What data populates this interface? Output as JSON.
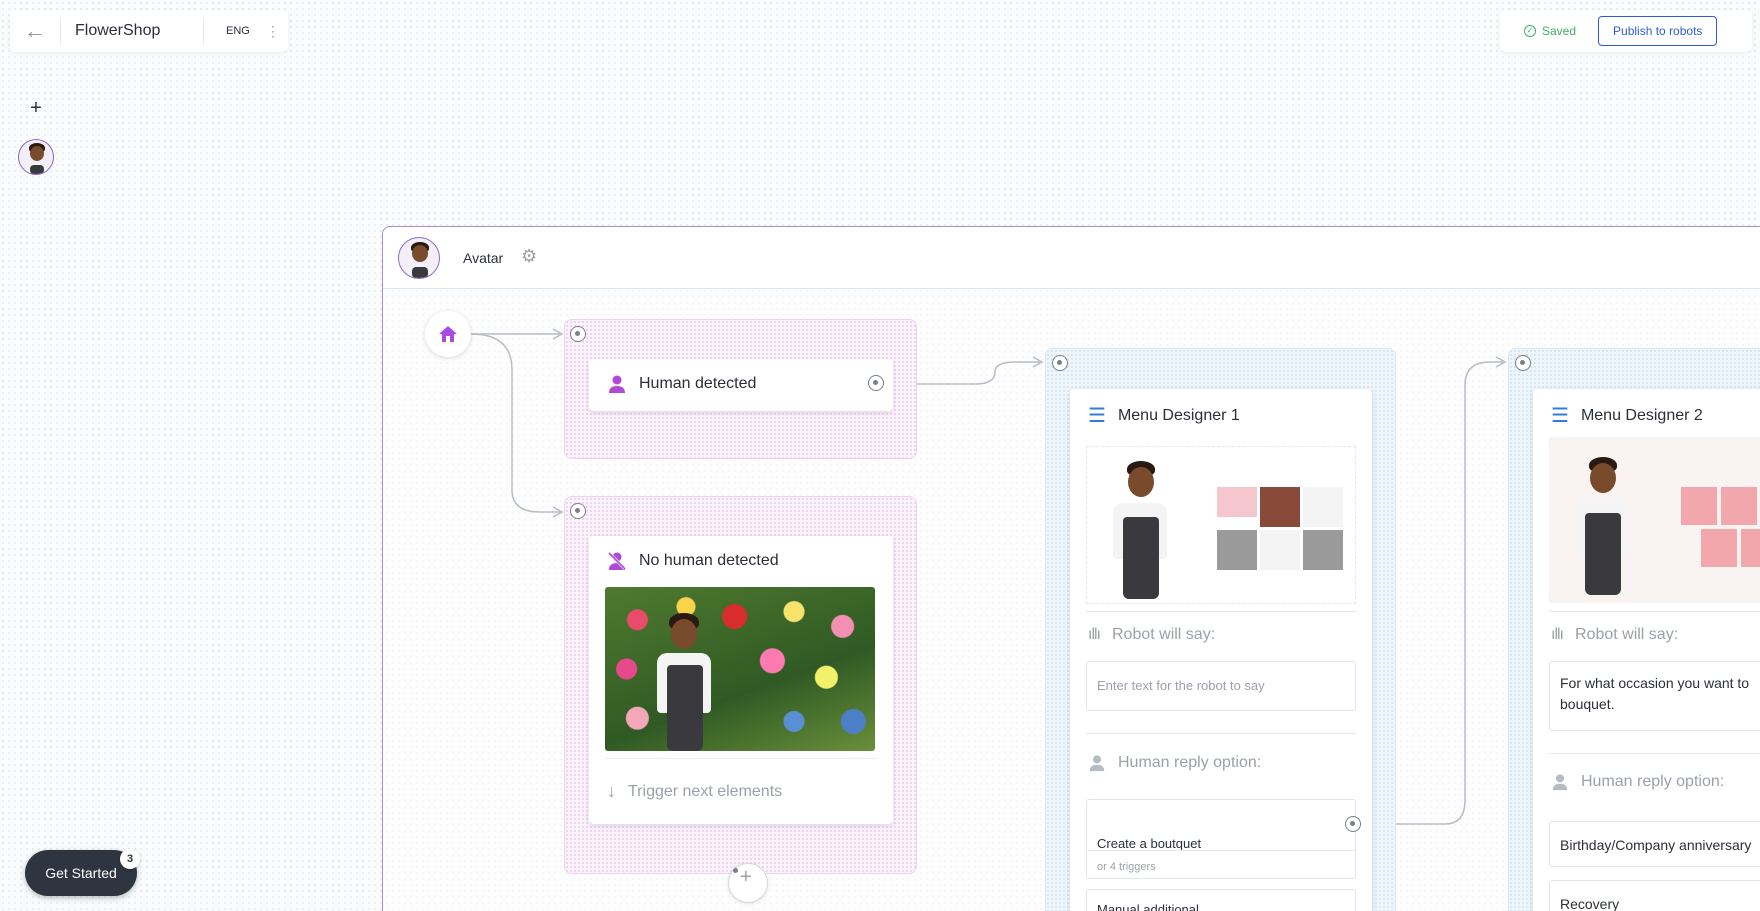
{
  "header": {
    "app_title": "FlowerShop",
    "language": "ENG",
    "saved_label": "Saved",
    "publish_label": "Publish to robots"
  },
  "left_toolbar": {
    "add_label": "+"
  },
  "canvas": {
    "frame_title": "Avatar",
    "trigger_human": {
      "label": "Human detected"
    },
    "trigger_no_human": {
      "label": "No human detected",
      "next_label": "Trigger next elements"
    },
    "menu1": {
      "title": "Menu Designer 1",
      "robot_say_label": "Robot will say:",
      "robot_say_placeholder": "Enter text for the robot to say",
      "human_reply_label": "Human reply option:",
      "reply1": "Create a boutquet",
      "reply1_sub": "or 4 triggers",
      "reply2_partial": "Manual additional..."
    },
    "menu2": {
      "title": "Menu Designer 2",
      "robot_say_label": "Robot will say:",
      "robot_say_text": "For what occasion you want to bouquet.",
      "human_reply_label": "Human reply option:",
      "reply1": "Birthday/Company anniversary",
      "reply2": "Recovery"
    }
  },
  "get_started": {
    "label": "Get Started",
    "badge": "3"
  },
  "colors": {
    "accent": "#2f5bd8",
    "saved": "#3fae6a",
    "purple": "#b04ad6",
    "frame": "#a58fd0"
  }
}
